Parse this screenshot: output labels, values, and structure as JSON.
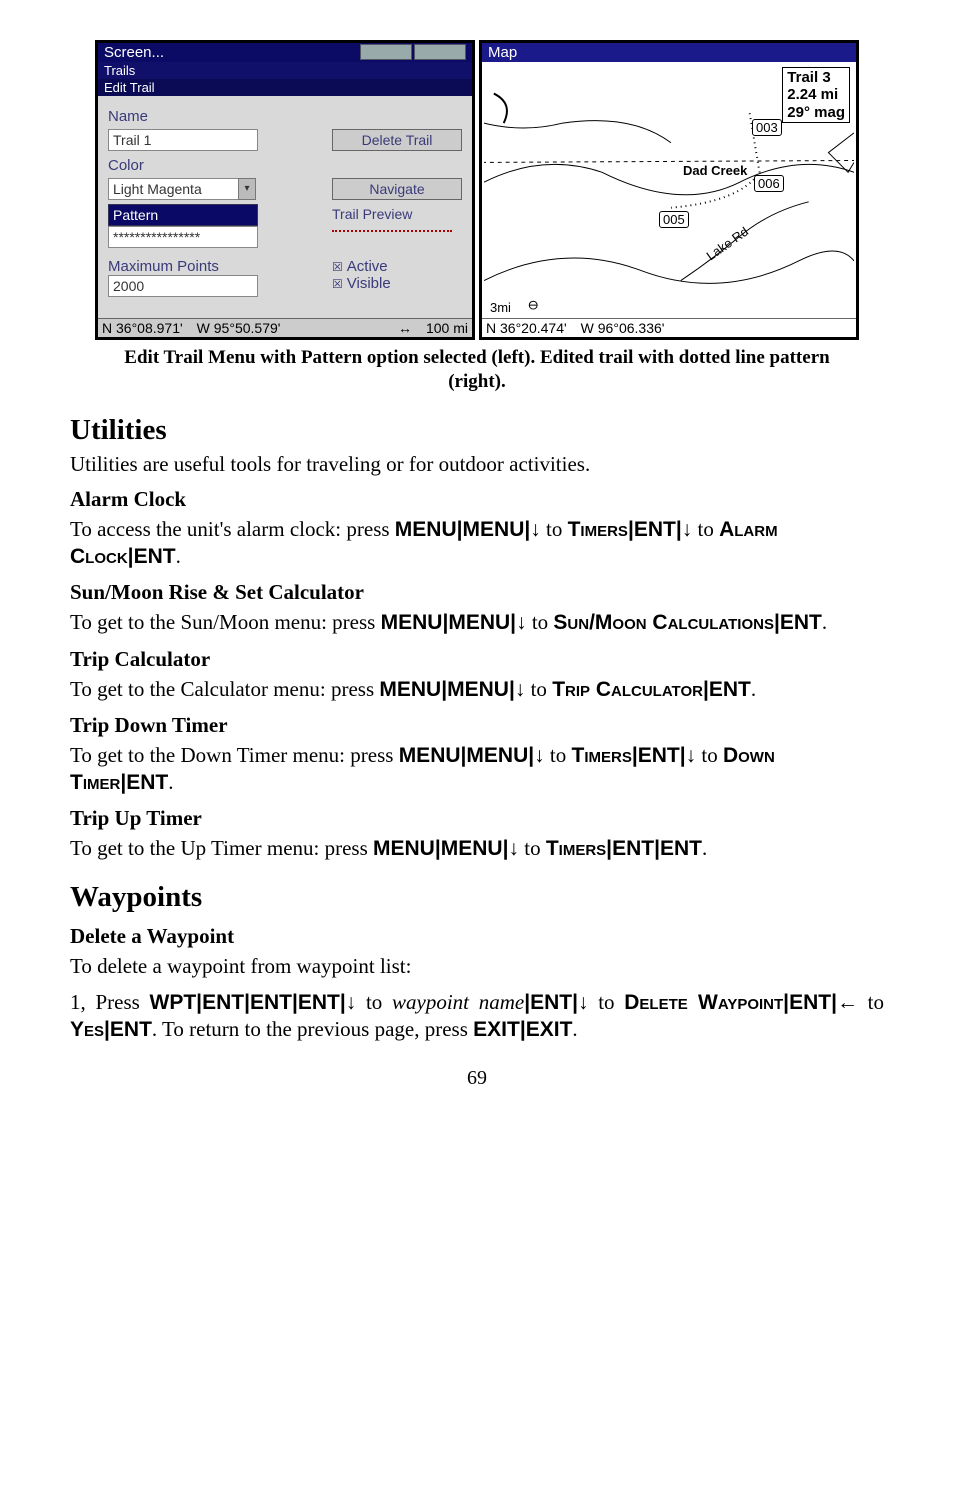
{
  "figure": {
    "left": {
      "titlebar_left": "Screen...",
      "titlebar_tab1": "",
      "titlebar_tab2": "",
      "trails_bar": "Trails",
      "edit_trail_bar": "Edit Trail",
      "name_label": "Name",
      "name_value": "Trail 1",
      "delete_btn": "Delete Trail",
      "color_label": "Color",
      "color_value": "Light Magenta",
      "navigate_btn": "Navigate",
      "pattern_label": "Pattern",
      "pattern_value": "****************",
      "preview_btn": "Trail Preview",
      "maxpts_label": "Maximum Points",
      "maxpts_value": "2000",
      "active_chk": "Active",
      "visible_chk": "Visible",
      "status_lat": "N   36°08.971'",
      "status_lon": "W   95°50.579'",
      "status_scale": "100 mi"
    },
    "right": {
      "titlebar": "Map",
      "info_line1": "Trail 3",
      "info_line2": "2.24 mi",
      "info_line3": "29° mag",
      "bubble_003": "003",
      "dad_creek": "Dad Creek",
      "bubble_006": "006",
      "bubble_005": "005",
      "lake_rd": "Lake Rd",
      "scale_label": "3mi",
      "status_lat": "N   36°20.474'",
      "status_lon": "W   96°06.336'"
    }
  },
  "caption": "Edit Trail Menu with Pattern option selected (left). Edited trail with dotted line pattern (right).",
  "sections": {
    "utilities_h": "Utilities",
    "utilities_intro": "Utilities are useful tools for traveling or for outdoor activities.",
    "alarm_h": "Alarm Clock",
    "alarm_p_parts": {
      "a": "To access the unit's alarm clock: press ",
      "menu1": "MENU",
      "sep1": "|",
      "menu2": "MENU",
      "sep2": "|",
      "arrow_dn1": "↓",
      "b": " to ",
      "timers": "Timers",
      "sep3": "|",
      "ent1": "ENT",
      "sep4": "|",
      "arrow_dn2": "↓",
      "c": " to ",
      "alarmclock": "Alarm Clock",
      "sep5": "|",
      "ent2": "ENT",
      "period": "."
    },
    "sunmoon_h": "Sun/Moon Rise & Set Calculator",
    "sunmoon_p": {
      "a": "To get to the Sun/Moon menu: press ",
      "menu1": "MENU",
      "sep1": "|",
      "menu2": "MENU",
      "sep2": "|",
      "arrow_dn": "↓",
      "b": " to ",
      "target": "Sun/Moon Calculations",
      "sep3": "|",
      "ent": "ENT",
      "period": "."
    },
    "tripcalc_h": "Trip Calculator",
    "tripcalc_p": {
      "a": "To get to the Calculator menu: press ",
      "menu1": "MENU",
      "sep1": "|",
      "menu2": "MENU",
      "sep2": "|",
      "arrow_dn": "↓",
      "b": " to ",
      "target": "Trip Calculator",
      "sep3": "|",
      "ent": "ENT",
      "period": "."
    },
    "tripdn_h": "Trip Down Timer",
    "tripdn_p": {
      "a": "To get to the Down Timer menu: press ",
      "menu1": "MENU",
      "sep1": "|",
      "menu2": "MENU",
      "sep2": "|",
      "arrow_dn1": "↓",
      "b": " to ",
      "timers": "Timers",
      "sep3": "|",
      "ent1": "ENT",
      "sep4": "|",
      "arrow_dn2": "↓",
      "c": " to ",
      "target": "Down Timer",
      "sep5": "|",
      "ent2": "ENT",
      "period": "."
    },
    "tripup_h": "Trip Up Timer",
    "tripup_p": {
      "a": "To get to the Up Timer menu: press ",
      "menu1": "MENU",
      "sep1": "|",
      "menu2": "MENU",
      "sep2": "|",
      "arrow_dn": "↓",
      "b": " to ",
      "timers": "Timers",
      "sep3": "|",
      "ent1": "ENT",
      "sep4": "|",
      "ent2": "ENT",
      "period": "."
    },
    "waypoints_h": "Waypoints",
    "delwp_h": "Delete a Waypoint",
    "delwp_intro": "To delete a waypoint from waypoint list:",
    "delwp_step": {
      "n": "1, Press ",
      "wpt": "WPT",
      "s1": "|",
      "ent1": "ENT",
      "s2": "|",
      "ent2": "ENT",
      "s3": "|",
      "ent3": "ENT",
      "s4": "|",
      "dn1": "↓",
      "a": " to ",
      "wpname": "waypoint name",
      "s5": "|",
      "ent4": "ENT",
      "s6": "|",
      "dn2": "↓",
      "b": " to ",
      "delwp": "Delete Waypoint",
      "s7": "|",
      "ent5": "ENT",
      "s8": "|",
      "left": "←",
      "c": " to ",
      "yes": "Yes",
      "s9": "|",
      "ent6": "ENT",
      "d": ". To return to the previous page, press ",
      "exit1": "EXIT",
      "s10": "|",
      "exit2": "EXIT",
      "period": "."
    }
  },
  "page_number": "69"
}
